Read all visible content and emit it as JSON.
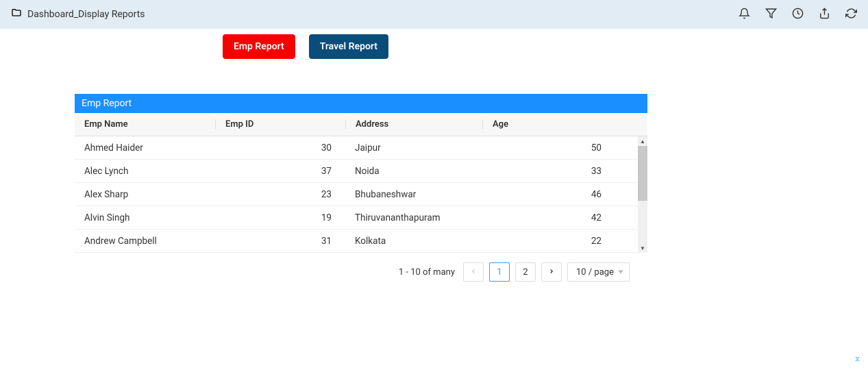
{
  "header": {
    "title": "Dashboard_Display Reports"
  },
  "tabs": {
    "emp_label": "Emp Report",
    "travel_label": "Travel Report"
  },
  "panel": {
    "title": "Emp Report",
    "columns": {
      "name": "Emp Name",
      "id": "Emp ID",
      "address": "Address",
      "age": "Age"
    },
    "rows": [
      {
        "name": "Ahmed Haider",
        "id": "30",
        "address": "Jaipur",
        "age": "50"
      },
      {
        "name": "Alec Lynch",
        "id": "37",
        "address": "Noida",
        "age": "33"
      },
      {
        "name": "Alex Sharp",
        "id": "23",
        "address": "Bhubaneshwar",
        "age": "46"
      },
      {
        "name": "Alvin Singh",
        "id": "19",
        "address": "Thiruvananthapuram",
        "age": "42"
      },
      {
        "name": "Andrew Campbell",
        "id": "31",
        "address": "Kolkata",
        "age": "22"
      }
    ]
  },
  "pager": {
    "range_text": "1 - 10 of many",
    "pages": {
      "p1": "1",
      "p2": "2"
    },
    "size_label": "10 / page"
  }
}
